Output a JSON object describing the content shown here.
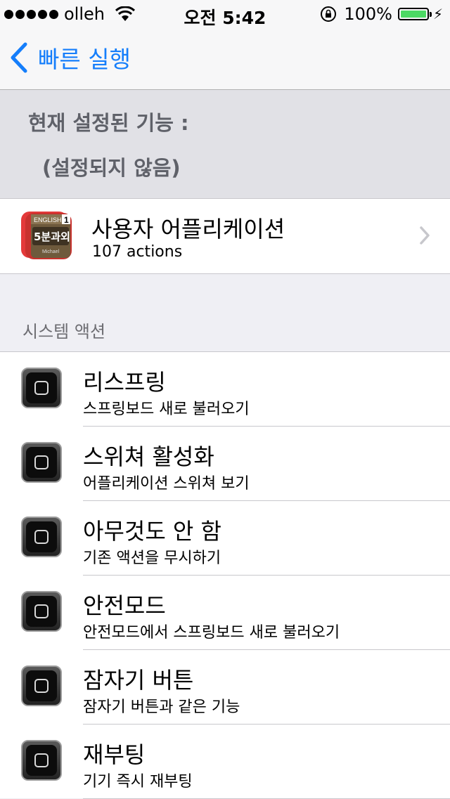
{
  "status_bar": {
    "carrier": "olleh",
    "time": "오전 5:42",
    "battery_percent": "100%",
    "battery_color": "#4cd964"
  },
  "nav": {
    "back_label": "빠른 실행",
    "tint_color": "#157efb"
  },
  "current_setting": {
    "title": "현재 설정된 기능 :",
    "value": "(설정되지 않음)"
  },
  "user_app": {
    "title": "사용자 어플리케이션",
    "subtitle": "107 actions",
    "icon": "english-5min-app-icon",
    "icon_label_top": "ENGLISH",
    "icon_label_num": "1",
    "icon_label_mid": "5분과외",
    "icon_label_bottom": "Michael"
  },
  "system_section": {
    "header": "시스템 액션",
    "items": [
      {
        "title": "리스프링",
        "subtitle": "스프링보드 새로 불러오기",
        "icon": "home-button-icon"
      },
      {
        "title": "스위쳐 활성화",
        "subtitle": "어플리케이션 스위쳐 보기",
        "icon": "home-button-icon"
      },
      {
        "title": "아무것도 안 함",
        "subtitle": "기존 액션을 무시하기",
        "icon": "home-button-icon"
      },
      {
        "title": "안전모드",
        "subtitle": "안전모드에서 스프링보드 새로 불러오기",
        "icon": "home-button-icon"
      },
      {
        "title": "잠자기 버튼",
        "subtitle": "잠자기 버튼과 같은 기능",
        "icon": "home-button-icon"
      },
      {
        "title": "재부팅",
        "subtitle": "기기 즉시 재부팅",
        "icon": "home-button-icon"
      }
    ]
  }
}
